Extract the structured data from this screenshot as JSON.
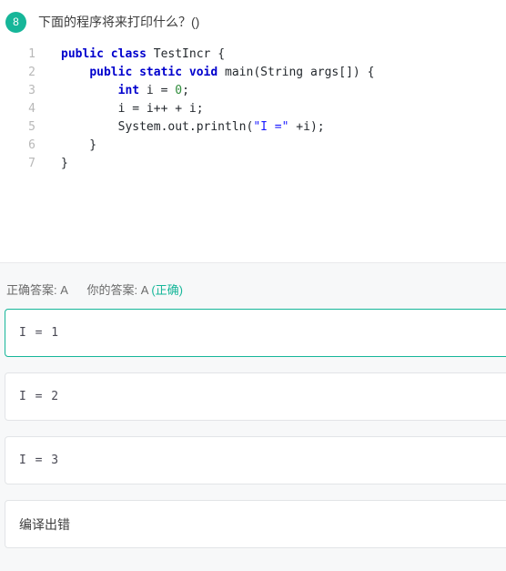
{
  "question": {
    "number": "8",
    "title": "下面的程序将来打印什么？()",
    "badge_color": "#16b699"
  },
  "code": {
    "language": "java",
    "line_numbers": [
      "1",
      "2",
      "3",
      "4",
      "5",
      "6",
      "7"
    ],
    "lines": [
      [
        {
          "t": "public class",
          "c": "kw"
        },
        {
          "t": " TestIncr {",
          "c": "pln"
        }
      ],
      [
        {
          "t": "    ",
          "c": "pln"
        },
        {
          "t": "public static void",
          "c": "kw"
        },
        {
          "t": " main(String args[]) {",
          "c": "pln"
        }
      ],
      [
        {
          "t": "        ",
          "c": "pln"
        },
        {
          "t": "int",
          "c": "kw"
        },
        {
          "t": " i = ",
          "c": "pln"
        },
        {
          "t": "0",
          "c": "num"
        },
        {
          "t": ";",
          "c": "pln"
        }
      ],
      [
        {
          "t": "        i = i++ + i;",
          "c": "pln"
        }
      ],
      [
        {
          "t": "        System.out.println(",
          "c": "pln"
        },
        {
          "t": "\"I =\"",
          "c": "str"
        },
        {
          "t": " +i);",
          "c": "pln"
        }
      ],
      [
        {
          "t": "    }",
          "c": "pln"
        }
      ],
      [
        {
          "t": "}",
          "c": "pln"
        }
      ]
    ]
  },
  "answer_summary": {
    "correct_label": "正确答案:",
    "correct_value": "A",
    "your_label": "你的答案:",
    "your_value": "A",
    "result_flag": "(正确)",
    "result_color": "#16b699"
  },
  "options": [
    {
      "text": "I = 1",
      "selected": true,
      "cjk": false
    },
    {
      "text": "I = 2",
      "selected": false,
      "cjk": false
    },
    {
      "text": "I = 3",
      "selected": false,
      "cjk": false
    },
    {
      "text": "编译出错",
      "selected": false,
      "cjk": true
    }
  ]
}
